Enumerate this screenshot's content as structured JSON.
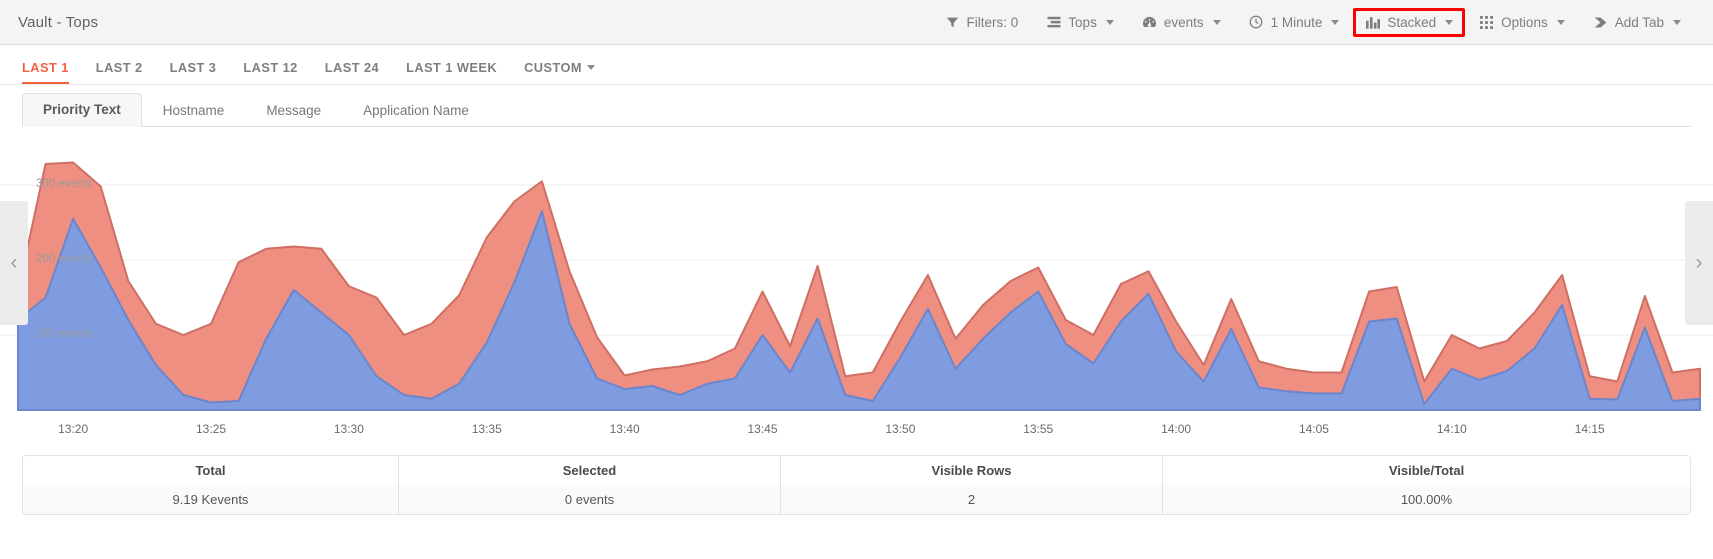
{
  "header": {
    "title": "Vault - Tops",
    "actions": [
      {
        "label": "Filters: 0",
        "icon": "filter-icon",
        "caret": false,
        "highlighted": false
      },
      {
        "label": "Tops",
        "icon": "list-icon",
        "caret": true,
        "highlighted": false
      },
      {
        "label": "events",
        "icon": "gauge-icon",
        "caret": true,
        "highlighted": false
      },
      {
        "label": "1 Minute",
        "icon": "clock-icon",
        "caret": true,
        "highlighted": false
      },
      {
        "label": "Stacked",
        "icon": "bar-chart-icon",
        "caret": true,
        "highlighted": true
      },
      {
        "label": "Options",
        "icon": "grid-icon",
        "caret": true,
        "highlighted": false
      },
      {
        "label": "Add Tab",
        "icon": "tag-icon",
        "caret": true,
        "highlighted": false
      }
    ]
  },
  "range_tabs": [
    {
      "label": "LAST 1",
      "active": true,
      "caret": false
    },
    {
      "label": "LAST 2",
      "active": false,
      "caret": false
    },
    {
      "label": "LAST 3",
      "active": false,
      "caret": false
    },
    {
      "label": "LAST 12",
      "active": false,
      "caret": false
    },
    {
      "label": "LAST 24",
      "active": false,
      "caret": false
    },
    {
      "label": "LAST 1 WEEK",
      "active": false,
      "caret": false
    },
    {
      "label": "CUSTOM",
      "active": false,
      "caret": true
    }
  ],
  "field_tabs": [
    {
      "label": "Priority Text",
      "active": true
    },
    {
      "label": "Hostname",
      "active": false
    },
    {
      "label": "Message",
      "active": false
    },
    {
      "label": "Application Name",
      "active": false
    }
  ],
  "chart_nav": {
    "prev": "‹",
    "next": "›"
  },
  "summary": {
    "headers": [
      "Total",
      "Selected",
      "Visible Rows",
      "Visible/Total"
    ],
    "values": [
      "9.19 Kevents",
      "0 events",
      "2",
      "100.00%"
    ]
  },
  "chart_data": {
    "type": "area",
    "stacked": true,
    "title": "",
    "xlabel": "",
    "ylabel": "events",
    "ylim": [
      0,
      340
    ],
    "grid": true,
    "legend_position": "none",
    "colors": {
      "series_1": "#7f9ce0",
      "series_2": "#ee8f82",
      "series_1_line": "#6b86cc",
      "series_2_line": "#cf6f63"
    },
    "y_ticks": [
      {
        "value": 100,
        "label": "100 events"
      },
      {
        "value": 200,
        "label": "200 events"
      },
      {
        "value": 300,
        "label": "300 events"
      }
    ],
    "x_ticks": [
      {
        "label": "13:20",
        "index": 2
      },
      {
        "label": "13:25",
        "index": 7
      },
      {
        "label": "13:30",
        "index": 12
      },
      {
        "label": "13:35",
        "index": 17
      },
      {
        "label": "13:40",
        "index": 22
      },
      {
        "label": "13:45",
        "index": 27
      },
      {
        "label": "13:50",
        "index": 32
      },
      {
        "label": "13:55",
        "index": 37
      },
      {
        "label": "14:00",
        "index": 42
      },
      {
        "label": "14:05",
        "index": 47
      },
      {
        "label": "14:10",
        "index": 52
      },
      {
        "label": "14:15",
        "index": 57
      }
    ],
    "x_start_minutes": "13:18",
    "series": [
      {
        "name": "series_1",
        "values": [
          120,
          150,
          255,
          190,
          120,
          60,
          20,
          10,
          12,
          95,
          160,
          130,
          100,
          45,
          20,
          15,
          35,
          90,
          170,
          265,
          115,
          42,
          28,
          32,
          20,
          35,
          42,
          100,
          50,
          122,
          20,
          12,
          70,
          135,
          55,
          95,
          130,
          158,
          88,
          62,
          118,
          155,
          78,
          38,
          108,
          30,
          25,
          22,
          22,
          118,
          122,
          8,
          55,
          40,
          52,
          82,
          140,
          15,
          14,
          110,
          12,
          15
        ]
      },
      {
        "name": "series_2",
        "values": [
          38,
          178,
          75,
          108,
          52,
          55,
          80,
          105,
          185,
          120,
          58,
          85,
          65,
          105,
          80,
          100,
          118,
          140,
          108,
          40,
          70,
          55,
          18,
          22,
          38,
          30,
          40,
          58,
          35,
          70,
          25,
          38,
          48,
          45,
          40,
          45,
          42,
          32,
          32,
          38,
          50,
          30,
          40,
          22,
          40,
          35,
          30,
          28,
          28,
          40,
          42,
          30,
          45,
          42,
          40,
          48,
          40,
          30,
          24,
          42,
          38,
          40
        ]
      }
    ]
  }
}
